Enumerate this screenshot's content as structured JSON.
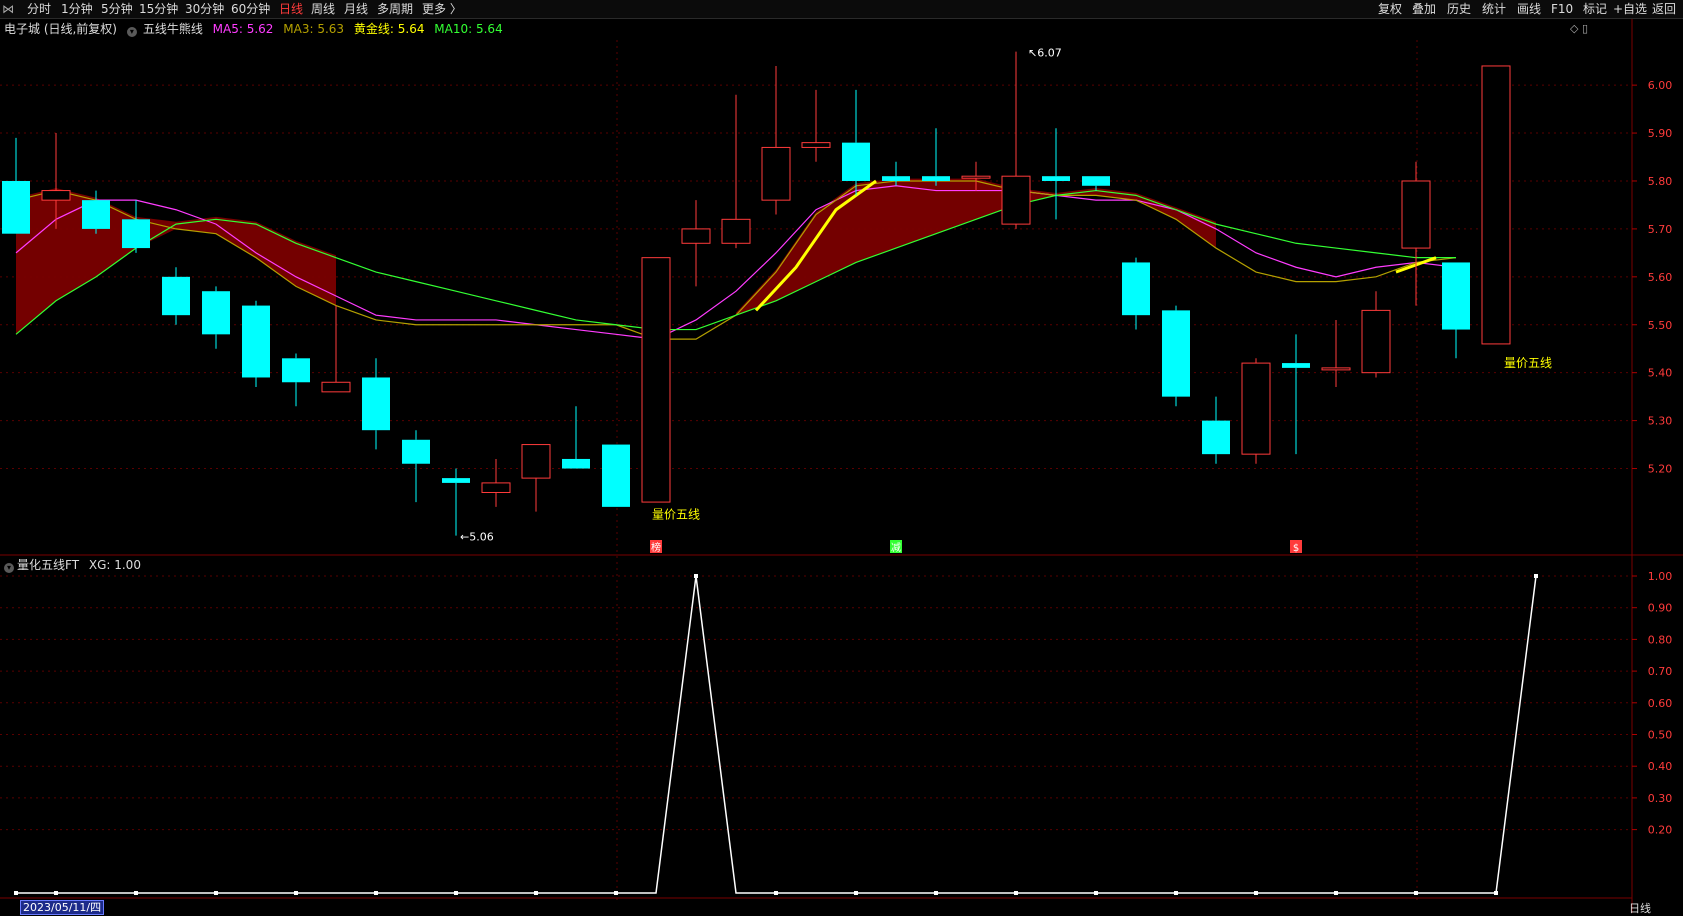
{
  "toolbar": {
    "periods": [
      "分时",
      "1分钟",
      "5分钟",
      "15分钟",
      "30分钟",
      "60分钟",
      "日线",
      "周线",
      "月线",
      "多周期",
      "更多 〉"
    ],
    "active_period": "日线",
    "right_buttons": [
      "复权",
      "叠加",
      "历史",
      "统计",
      "画线",
      "F10",
      "标记",
      "+自选",
      "返回"
    ]
  },
  "main_chart": {
    "stock_label": "电子城 (日线,前复权)",
    "indicator_name": "五线牛熊线",
    "ma5": "MA5: 5.62",
    "ma3": "MA3: 5.63",
    "gold": "黄金线: 5.64",
    "ma10": "MA10: 5.64",
    "high_label": "6.07",
    "low_label": "5.06",
    "annotations": [
      "量价五线",
      "量价五线"
    ],
    "markers": [
      "榜",
      "减",
      "$"
    ],
    "colors": {
      "up": "#ff3b3b",
      "down": "#00ffff",
      "ma5": "#ff3cff",
      "ma3": "#b4a000",
      "gold": "#ffff00",
      "ma10": "#33ff33",
      "cloud": "#7a0000"
    }
  },
  "sub_chart": {
    "label": "量化五线FT",
    "value": "XG: 1.00"
  },
  "footer": {
    "date": "2023/05/11/四",
    "period": "日线"
  },
  "chart_data": [
    {
      "type": "candlestick",
      "title": "电子城 (日线,前复权)",
      "yticks": [
        6.0,
        5.9,
        5.8,
        5.7,
        5.6,
        5.5,
        5.4,
        5.3,
        5.2
      ],
      "ylim": [
        5.03,
        6.09
      ],
      "candles": [
        {
          "o": 5.8,
          "h": 5.89,
          "l": 5.69,
          "c": 5.69
        },
        {
          "o": 5.76,
          "h": 5.9,
          "l": 5.7,
          "c": 5.78
        },
        {
          "o": 5.76,
          "h": 5.78,
          "l": 5.69,
          "c": 5.7
        },
        {
          "o": 5.72,
          "h": 5.76,
          "l": 5.65,
          "c": 5.66
        },
        {
          "o": 5.6,
          "h": 5.62,
          "l": 5.5,
          "c": 5.52
        },
        {
          "o": 5.57,
          "h": 5.58,
          "l": 5.45,
          "c": 5.48
        },
        {
          "o": 5.54,
          "h": 5.55,
          "l": 5.37,
          "c": 5.39
        },
        {
          "o": 5.43,
          "h": 5.44,
          "l": 5.33,
          "c": 5.38
        },
        {
          "o": 5.36,
          "h": 5.54,
          "l": 5.36,
          "c": 5.38
        },
        {
          "o": 5.39,
          "h": 5.43,
          "l": 5.24,
          "c": 5.28
        },
        {
          "o": 5.26,
          "h": 5.28,
          "l": 5.13,
          "c": 5.21
        },
        {
          "o": 5.18,
          "h": 5.2,
          "l": 5.06,
          "c": 5.17
        },
        {
          "o": 5.15,
          "h": 5.22,
          "l": 5.12,
          "c": 5.17
        },
        {
          "o": 5.18,
          "h": 5.25,
          "l": 5.11,
          "c": 5.25
        },
        {
          "o": 5.22,
          "h": 5.33,
          "l": 5.2,
          "c": 5.2
        },
        {
          "o": 5.25,
          "h": 5.25,
          "l": 5.12,
          "c": 5.12
        },
        {
          "o": 5.13,
          "h": 5.64,
          "l": 5.13,
          "c": 5.64
        },
        {
          "o": 5.67,
          "h": 5.76,
          "l": 5.58,
          "c": 5.7
        },
        {
          "o": 5.67,
          "h": 5.98,
          "l": 5.66,
          "c": 5.72
        },
        {
          "o": 5.76,
          "h": 6.04,
          "l": 5.73,
          "c": 5.87
        },
        {
          "o": 5.87,
          "h": 5.99,
          "l": 5.84,
          "c": 5.88
        },
        {
          "o": 5.88,
          "h": 5.99,
          "l": 5.77,
          "c": 5.8
        },
        {
          "o": 5.81,
          "h": 5.84,
          "l": 5.79,
          "c": 5.8
        },
        {
          "o": 5.81,
          "h": 5.91,
          "l": 5.79,
          "c": 5.8
        },
        {
          "o": 5.81,
          "h": 5.84,
          "l": 5.78,
          "c": 5.81
        },
        {
          "o": 5.71,
          "h": 6.07,
          "l": 5.7,
          "c": 5.81
        },
        {
          "o": 5.81,
          "h": 5.91,
          "l": 5.72,
          "c": 5.8
        },
        {
          "o": 5.81,
          "h": 5.81,
          "l": 5.78,
          "c": 5.79
        },
        {
          "o": 5.63,
          "h": 5.64,
          "l": 5.49,
          "c": 5.52
        },
        {
          "o": 5.53,
          "h": 5.54,
          "l": 5.33,
          "c": 5.35
        },
        {
          "o": 5.3,
          "h": 5.35,
          "l": 5.21,
          "c": 5.23
        },
        {
          "o": 5.23,
          "h": 5.43,
          "l": 5.21,
          "c": 5.42
        },
        {
          "o": 5.42,
          "h": 5.48,
          "l": 5.23,
          "c": 5.41
        },
        {
          "o": 5.41,
          "h": 5.51,
          "l": 5.37,
          "c": 5.41
        },
        {
          "o": 5.4,
          "h": 5.57,
          "l": 5.39,
          "c": 5.53
        },
        {
          "o": 5.66,
          "h": 5.84,
          "l": 5.54,
          "c": 5.8
        },
        {
          "o": 5.63,
          "h": 5.63,
          "l": 5.43,
          "c": 5.49
        },
        {
          "o": 5.46,
          "h": 6.04,
          "l": 5.46,
          "c": 6.04
        }
      ],
      "series": [
        {
          "name": "MA5",
          "color": "#ff3cff",
          "values": [
            5.65,
            5.72,
            5.76,
            5.76,
            5.74,
            5.71,
            5.65,
            5.6,
            5.56,
            5.52,
            5.51,
            5.51,
            5.51,
            5.5,
            5.49,
            5.48,
            5.47,
            5.51,
            5.57,
            5.65,
            5.74,
            5.78,
            5.79,
            5.78,
            5.78,
            5.78,
            5.77,
            5.76,
            5.76,
            5.74,
            5.7,
            5.65,
            5.62,
            5.6,
            5.62,
            5.63,
            5.62
          ]
        },
        {
          "name": "MA3",
          "color": "#b4a000",
          "values": [
            5.76,
            5.78,
            5.76,
            5.72,
            5.7,
            5.69,
            5.64,
            5.58,
            5.54,
            5.51,
            5.5,
            5.5,
            5.5,
            5.5,
            5.5,
            5.5,
            5.47,
            5.47,
            5.52,
            5.61,
            5.73,
            5.79,
            5.8,
            5.8,
            5.8,
            5.78,
            5.77,
            5.77,
            5.76,
            5.72,
            5.66,
            5.61,
            5.59,
            5.59,
            5.6,
            5.63,
            5.64
          ]
        },
        {
          "name": "MA10",
          "color": "#33ff33",
          "values": [
            5.48,
            5.55,
            5.6,
            5.66,
            5.71,
            5.72,
            5.71,
            5.67,
            5.64,
            5.61,
            5.59,
            5.57,
            5.55,
            5.53,
            5.51,
            5.5,
            5.49,
            5.49,
            5.52,
            5.55,
            5.59,
            5.63,
            5.66,
            5.69,
            5.72,
            5.75,
            5.77,
            5.78,
            5.77,
            5.74,
            5.71,
            5.69,
            5.67,
            5.66,
            5.65,
            5.64,
            5.64
          ]
        }
      ]
    },
    {
      "type": "line",
      "title": "量化五线FT",
      "series": [
        {
          "name": "XG",
          "values": [
            0,
            0,
            0,
            0,
            0,
            0,
            0,
            0,
            0,
            0,
            0,
            0,
            0,
            0,
            0,
            0,
            1,
            0,
            0,
            0,
            0,
            0,
            0,
            0,
            0,
            0,
            0,
            0,
            0,
            0,
            0,
            0,
            0,
            0,
            0,
            0,
            0,
            1
          ]
        }
      ],
      "yticks": [
        1.0,
        0.9,
        0.8,
        0.7,
        0.6,
        0.5,
        0.4,
        0.3,
        0.2
      ],
      "ylim": [
        0,
        1
      ]
    }
  ]
}
